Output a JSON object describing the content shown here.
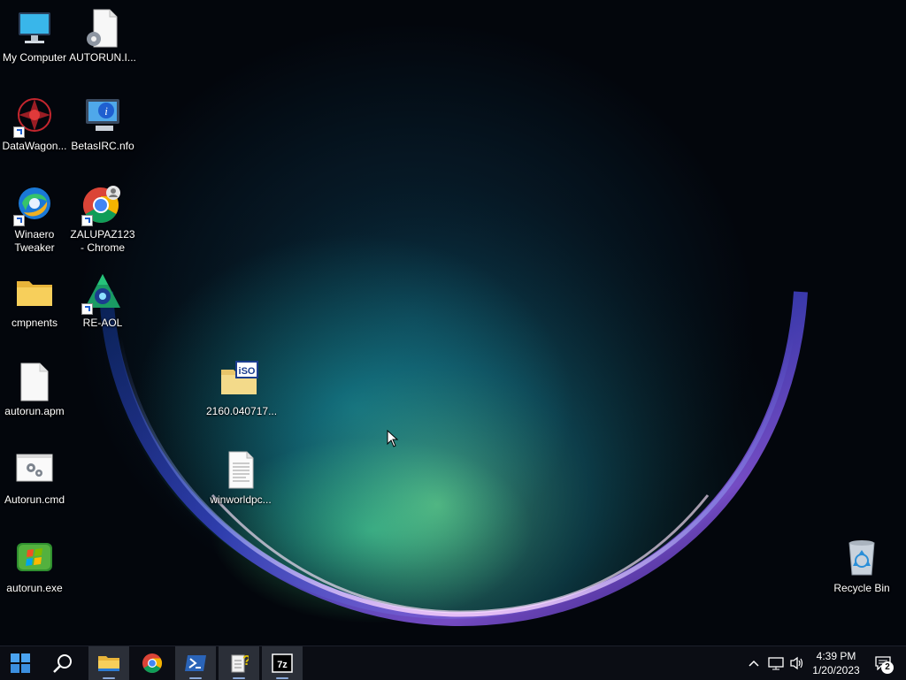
{
  "desktop": {
    "icons": [
      {
        "label": "My Computer",
        "icon": "computer-icon"
      },
      {
        "label": "AUTORUN.I...",
        "icon": "settings-file-icon"
      },
      {
        "label": "DataWagon...",
        "icon": "datawagon-icon"
      },
      {
        "label": "BetasIRC.nfo",
        "icon": "info-file-icon"
      },
      {
        "label": "Winaero\nTweaker",
        "icon": "winaero-tweaker-icon"
      },
      {
        "label": "ZALUPAZ123\n- Chrome",
        "icon": "chrome-profile-icon"
      },
      {
        "label": "cmpnents",
        "icon": "folder-icon"
      },
      {
        "label": "RE-AOL",
        "icon": "aol-icon"
      },
      {
        "label": "autorun.apm",
        "icon": "blank-file-icon"
      },
      {
        "label": "2160.040717...",
        "icon": "iso-archive-icon"
      },
      {
        "label": "Autorun.cmd",
        "icon": "cmd-script-icon"
      },
      {
        "label": "winworldpc...",
        "icon": "text-file-icon"
      },
      {
        "label": "autorun.exe",
        "icon": "windows-exe-icon"
      },
      {
        "label": "Recycle Bin",
        "icon": "recycle-bin-icon"
      }
    ]
  },
  "taskbar": {
    "buttons": [
      {
        "name": "start",
        "icon": "windows-start-icon"
      },
      {
        "name": "search",
        "icon": "search-icon"
      },
      {
        "name": "file-explorer",
        "icon": "file-explorer-icon"
      },
      {
        "name": "chrome",
        "icon": "chrome-icon"
      },
      {
        "name": "powershell",
        "icon": "powershell-icon"
      },
      {
        "name": "help-file",
        "icon": "help-file-icon"
      },
      {
        "name": "7-zip",
        "icon": "7zip-icon"
      }
    ],
    "tray": {
      "chevron_icon": "chevron-up-icon",
      "network_icon": "network-icon",
      "volume_icon": "volume-icon",
      "time": "4:39 PM",
      "date": "1/20/2023",
      "notification_count": "2"
    }
  },
  "colors": {
    "accent": "#1f6fd0",
    "taskbar": "#0b0d14",
    "folder": "#f5c94a"
  }
}
